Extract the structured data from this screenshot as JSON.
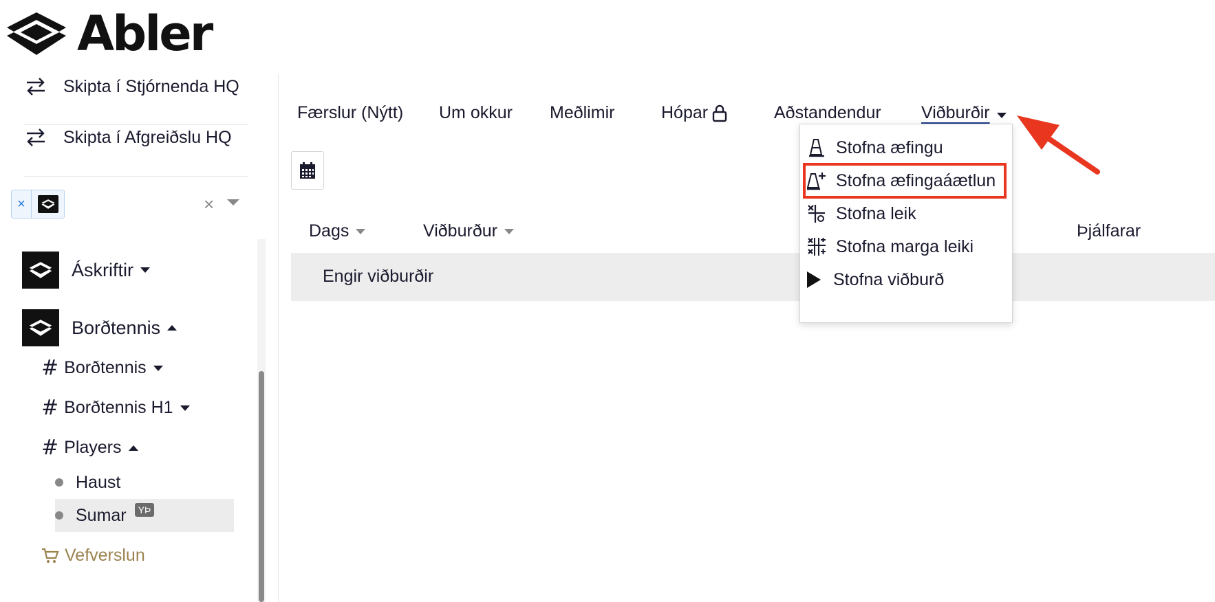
{
  "header": {
    "logo_text": "Abler"
  },
  "sidebar": {
    "switch_items": [
      {
        "label": "Skipta í Stjórnenda HQ"
      },
      {
        "label": "Skipta í Afgreiðslu HQ"
      }
    ],
    "groups": [
      {
        "label": "Áskriftir"
      },
      {
        "label": "Borðtennis"
      }
    ],
    "sub_items": [
      {
        "label": "Borðtennis"
      },
      {
        "label": "Borðtennis H1"
      },
      {
        "label": "Players"
      }
    ],
    "leaves": [
      {
        "label": "Haust"
      },
      {
        "label": "Sumar",
        "badge": "YÞ"
      }
    ],
    "shop": {
      "label": "Vefverslun"
    }
  },
  "main": {
    "tabs": [
      {
        "label": "Færslur (Nýtt)"
      },
      {
        "label": "Um okkur"
      },
      {
        "label": "Meðlimir"
      },
      {
        "label": "Hópar"
      },
      {
        "label": "Aðstandendur"
      },
      {
        "label": "Viðburðir"
      }
    ],
    "table": {
      "headers": [
        "Dags",
        "Viðburður",
        "Þjálfarar"
      ],
      "empty_text": "Engir viðburðir"
    }
  },
  "dropdown": {
    "items": [
      {
        "label": "Stofna æfingu",
        "icon": "cone-icon"
      },
      {
        "label": "Stofna æfingaáætlun",
        "icon": "cone-plus-icon"
      },
      {
        "label": "Stofna leik",
        "icon": "versus-icon"
      },
      {
        "label": "Stofna marga leiki",
        "icon": "multi-versus-icon"
      },
      {
        "label": "Stofna viðburð",
        "icon": "play-icon"
      }
    ]
  },
  "colors": {
    "highlight": "#e8361f",
    "arrow": "#e8361f",
    "shop": "#9b8350",
    "active_tab_underline": "#1a3a8a"
  }
}
